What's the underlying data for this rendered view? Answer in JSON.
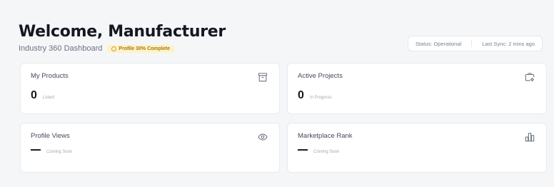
{
  "header": {
    "title": "Welcome, Manufacturer",
    "subtitle": "Industry 360 Dashboard",
    "badge": "Profile 30% Complete"
  },
  "status": {
    "status_text": "Status: Operational",
    "sync_text": "Last Sync: 2 mins ago"
  },
  "cards": [
    {
      "label": "My Products",
      "value": "0",
      "sub": "Listed",
      "icon": "archive-icon"
    },
    {
      "label": "Active Projects",
      "value": "0",
      "sub": "In Progress",
      "icon": "briefcase-settings-icon"
    },
    {
      "label": "Profile Views",
      "value": "—",
      "sub": "Coming Soon",
      "icon": "eye-icon"
    },
    {
      "label": "Marketplace Rank",
      "value": "—",
      "sub": "Coming Soon",
      "icon": "bar-chart-icon"
    }
  ],
  "colors": {
    "background": "#f5f6f8",
    "card": "#ffffff",
    "badge_bg": "#fdf2c9",
    "badge_text": "#a87b06",
    "muted": "#6b7280"
  }
}
